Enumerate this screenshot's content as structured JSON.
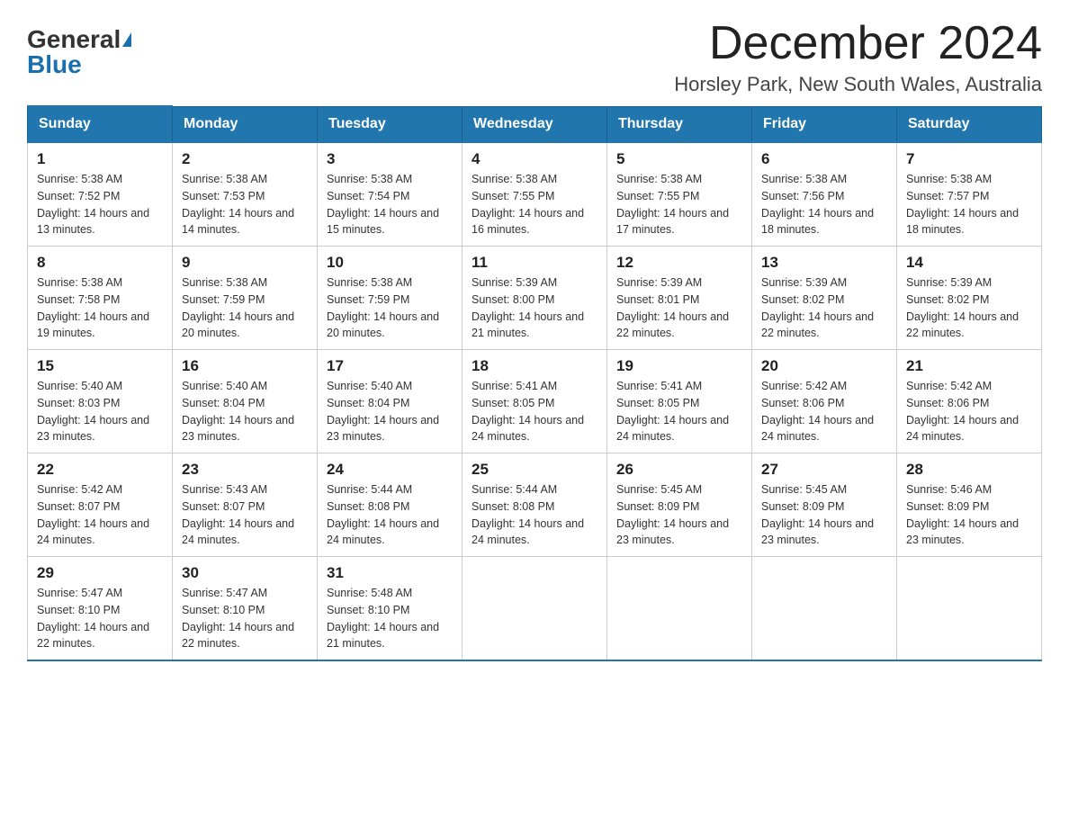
{
  "header": {
    "logo_general": "General",
    "logo_blue": "Blue",
    "main_title": "December 2024",
    "subtitle": "Horsley Park, New South Wales, Australia"
  },
  "calendar": {
    "days_of_week": [
      "Sunday",
      "Monday",
      "Tuesday",
      "Wednesday",
      "Thursday",
      "Friday",
      "Saturday"
    ],
    "weeks": [
      [
        {
          "day": "1",
          "sunrise": "5:38 AM",
          "sunset": "7:52 PM",
          "daylight": "14 hours and 13 minutes."
        },
        {
          "day": "2",
          "sunrise": "5:38 AM",
          "sunset": "7:53 PM",
          "daylight": "14 hours and 14 minutes."
        },
        {
          "day": "3",
          "sunrise": "5:38 AM",
          "sunset": "7:54 PM",
          "daylight": "14 hours and 15 minutes."
        },
        {
          "day": "4",
          "sunrise": "5:38 AM",
          "sunset": "7:55 PM",
          "daylight": "14 hours and 16 minutes."
        },
        {
          "day": "5",
          "sunrise": "5:38 AM",
          "sunset": "7:55 PM",
          "daylight": "14 hours and 17 minutes."
        },
        {
          "day": "6",
          "sunrise": "5:38 AM",
          "sunset": "7:56 PM",
          "daylight": "14 hours and 18 minutes."
        },
        {
          "day": "7",
          "sunrise": "5:38 AM",
          "sunset": "7:57 PM",
          "daylight": "14 hours and 18 minutes."
        }
      ],
      [
        {
          "day": "8",
          "sunrise": "5:38 AM",
          "sunset": "7:58 PM",
          "daylight": "14 hours and 19 minutes."
        },
        {
          "day": "9",
          "sunrise": "5:38 AM",
          "sunset": "7:59 PM",
          "daylight": "14 hours and 20 minutes."
        },
        {
          "day": "10",
          "sunrise": "5:38 AM",
          "sunset": "7:59 PM",
          "daylight": "14 hours and 20 minutes."
        },
        {
          "day": "11",
          "sunrise": "5:39 AM",
          "sunset": "8:00 PM",
          "daylight": "14 hours and 21 minutes."
        },
        {
          "day": "12",
          "sunrise": "5:39 AM",
          "sunset": "8:01 PM",
          "daylight": "14 hours and 22 minutes."
        },
        {
          "day": "13",
          "sunrise": "5:39 AM",
          "sunset": "8:02 PM",
          "daylight": "14 hours and 22 minutes."
        },
        {
          "day": "14",
          "sunrise": "5:39 AM",
          "sunset": "8:02 PM",
          "daylight": "14 hours and 22 minutes."
        }
      ],
      [
        {
          "day": "15",
          "sunrise": "5:40 AM",
          "sunset": "8:03 PM",
          "daylight": "14 hours and 23 minutes."
        },
        {
          "day": "16",
          "sunrise": "5:40 AM",
          "sunset": "8:04 PM",
          "daylight": "14 hours and 23 minutes."
        },
        {
          "day": "17",
          "sunrise": "5:40 AM",
          "sunset": "8:04 PM",
          "daylight": "14 hours and 23 minutes."
        },
        {
          "day": "18",
          "sunrise": "5:41 AM",
          "sunset": "8:05 PM",
          "daylight": "14 hours and 24 minutes."
        },
        {
          "day": "19",
          "sunrise": "5:41 AM",
          "sunset": "8:05 PM",
          "daylight": "14 hours and 24 minutes."
        },
        {
          "day": "20",
          "sunrise": "5:42 AM",
          "sunset": "8:06 PM",
          "daylight": "14 hours and 24 minutes."
        },
        {
          "day": "21",
          "sunrise": "5:42 AM",
          "sunset": "8:06 PM",
          "daylight": "14 hours and 24 minutes."
        }
      ],
      [
        {
          "day": "22",
          "sunrise": "5:42 AM",
          "sunset": "8:07 PM",
          "daylight": "14 hours and 24 minutes."
        },
        {
          "day": "23",
          "sunrise": "5:43 AM",
          "sunset": "8:07 PM",
          "daylight": "14 hours and 24 minutes."
        },
        {
          "day": "24",
          "sunrise": "5:44 AM",
          "sunset": "8:08 PM",
          "daylight": "14 hours and 24 minutes."
        },
        {
          "day": "25",
          "sunrise": "5:44 AM",
          "sunset": "8:08 PM",
          "daylight": "14 hours and 24 minutes."
        },
        {
          "day": "26",
          "sunrise": "5:45 AM",
          "sunset": "8:09 PM",
          "daylight": "14 hours and 23 minutes."
        },
        {
          "day": "27",
          "sunrise": "5:45 AM",
          "sunset": "8:09 PM",
          "daylight": "14 hours and 23 minutes."
        },
        {
          "day": "28",
          "sunrise": "5:46 AM",
          "sunset": "8:09 PM",
          "daylight": "14 hours and 23 minutes."
        }
      ],
      [
        {
          "day": "29",
          "sunrise": "5:47 AM",
          "sunset": "8:10 PM",
          "daylight": "14 hours and 22 minutes."
        },
        {
          "day": "30",
          "sunrise": "5:47 AM",
          "sunset": "8:10 PM",
          "daylight": "14 hours and 22 minutes."
        },
        {
          "day": "31",
          "sunrise": "5:48 AM",
          "sunset": "8:10 PM",
          "daylight": "14 hours and 21 minutes."
        },
        null,
        null,
        null,
        null
      ]
    ]
  }
}
